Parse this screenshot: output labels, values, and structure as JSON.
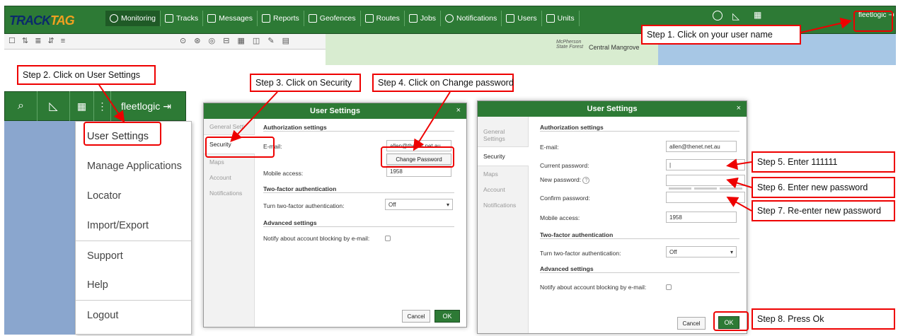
{
  "app": {
    "logo_part1": "TRACK",
    "logo_part2": "TAG"
  },
  "nav": [
    {
      "label": "Monitoring",
      "icon": "globe-icon"
    },
    {
      "label": "Tracks",
      "icon": "grid-icon"
    },
    {
      "label": "Messages",
      "icon": "list-icon"
    },
    {
      "label": "Reports",
      "icon": "report-icon"
    },
    {
      "label": "Geofences",
      "icon": "geofence-icon"
    },
    {
      "label": "Routes",
      "icon": "route-icon"
    },
    {
      "label": "Jobs",
      "icon": "check-icon"
    },
    {
      "label": "Notifications",
      "icon": "bell-icon"
    },
    {
      "label": "Users",
      "icon": "user-icon"
    },
    {
      "label": "Units",
      "icon": "car-icon"
    }
  ],
  "user": {
    "name": "fleetlogic"
  },
  "map": {
    "place1": "McPherson State Forest",
    "place2": "Central Mangrove"
  },
  "menu": {
    "items": [
      "User Settings",
      "Manage Applications",
      "Locator",
      "Import/Export",
      "Support",
      "Help",
      "Logout"
    ]
  },
  "steps": {
    "s1": "Step 1. Click on your user name",
    "s2": "Step 2. Click on User Settings",
    "s3": "Step 3. Click on Security",
    "s4": "Step 4. Click on Change password",
    "s5": "Step 5. Enter 111111",
    "s6": "Step 6. Enter new password",
    "s7": "Step 7. Re-enter new password",
    "s8": "Step 8. Press Ok"
  },
  "dialog": {
    "title": "User Settings",
    "close": "×",
    "tabs": [
      "General Settings",
      "Security",
      "Maps",
      "Account",
      "Notifications"
    ],
    "tabs_clipped": "General Setti",
    "auth_header": "Authorization settings",
    "email_label": "E-mail:",
    "email_value": "allen@thenet.net.au",
    "change_pw": "Change Password",
    "mobile_label": "Mobile access:",
    "mobile_value": "1958",
    "twofa_header": "Two-factor authentication",
    "twofa_label": "Turn two-factor authentication:",
    "twofa_value": "Off",
    "adv_header": "Advanced settings",
    "adv_label": "Notify about account blocking by e-mail:",
    "current_pw": "Current password:",
    "new_pw": "New password:",
    "help": "?",
    "confirm_pw": "Confirm password:",
    "cancel": "Cancel",
    "ok": "OK"
  },
  "colors": {
    "green": "#2d7a35",
    "red": "#e00000",
    "logo_orange": "#f0a020"
  }
}
